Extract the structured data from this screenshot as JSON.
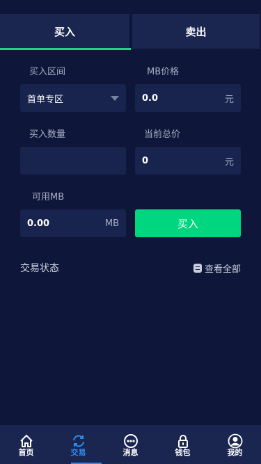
{
  "tabs": {
    "buy": "买入",
    "sell": "卖出",
    "active": "buy"
  },
  "form": {
    "range_label": "买入区间",
    "range_value": "首单专区",
    "price_label": "MB价格",
    "price_value": "0.0",
    "price_unit": "元",
    "qty_label": "买入数量",
    "qty_value": "",
    "total_label": "当前总价",
    "total_value": "0",
    "total_unit": "元",
    "available_label": "可用MB",
    "available_value": "0.00",
    "available_unit": "MB",
    "buy_button": "买入"
  },
  "status": {
    "title": "交易状态",
    "view_all": "查看全部"
  },
  "nav": [
    {
      "label": "首页",
      "icon": "home-icon"
    },
    {
      "label": "交易",
      "icon": "refresh-icon",
      "active": true
    },
    {
      "label": "消息",
      "icon": "message-icon"
    },
    {
      "label": "钱包",
      "icon": "lock-icon"
    },
    {
      "label": "我的",
      "icon": "user-icon"
    }
  ],
  "colors": {
    "background": "#0e1739",
    "accent": "#00d680",
    "nav_active": "#2d8cf0"
  }
}
